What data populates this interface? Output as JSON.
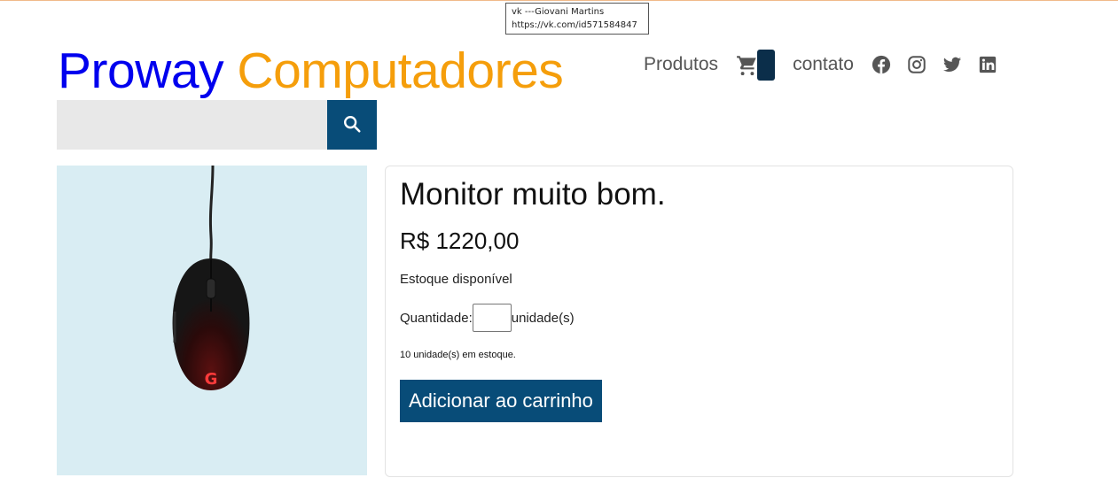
{
  "tooltip": {
    "line1": "vk ---Giovani Martins",
    "line2": "https://vk.com/id571584847"
  },
  "header": {
    "brand_part1": "Proway",
    "brand_part2": "Computadores",
    "nav": {
      "produtos": "Produtos",
      "cart_count": "",
      "contato": "contato"
    },
    "social_icons": [
      "facebook-icon",
      "instagram-icon",
      "twitter-icon",
      "linkedin-icon"
    ]
  },
  "search": {
    "value": "",
    "placeholder": ""
  },
  "product": {
    "image": "mouse-image",
    "title": "Monitor muito bom.",
    "price": "R$ 1220,00",
    "stock_status": "Estoque disponível",
    "quantity_label": "Quantidade:",
    "quantity_value": "",
    "quantity_unit": "unidade(s)",
    "units_in_stock": "10 unidade(s) em estoque.",
    "add_button": "Adicionar ao carrinho"
  },
  "colors": {
    "brand_blue": "#0000ee",
    "brand_orange": "#f59e0b",
    "primary": "#084c78",
    "image_bg": "#d9edf3",
    "search_bg": "#e8e8e8"
  }
}
